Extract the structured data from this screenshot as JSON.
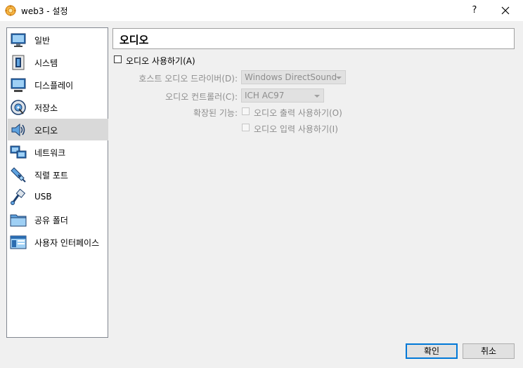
{
  "window": {
    "title": "web3 - 설정",
    "help_glyph": "?",
    "accent": "#0078d7"
  },
  "sidebar": {
    "items": [
      {
        "label": "일반",
        "icon": "general-monitor-icon"
      },
      {
        "label": "시스템",
        "icon": "system-chip-icon"
      },
      {
        "label": "디스플레이",
        "icon": "display-monitor-icon"
      },
      {
        "label": "저장소",
        "icon": "storage-disk-icon"
      },
      {
        "label": "오디오",
        "icon": "audio-speaker-icon",
        "selected": true
      },
      {
        "label": "네트워크",
        "icon": "network-icon"
      },
      {
        "label": "직렬 포트",
        "icon": "serial-port-icon"
      },
      {
        "label": "USB",
        "icon": "usb-icon"
      },
      {
        "label": "공유 폴더",
        "icon": "shared-folder-icon"
      },
      {
        "label": "사용자 인터페이스",
        "icon": "user-interface-icon"
      }
    ]
  },
  "page": {
    "title": "오디오",
    "enable_audio_label": "오디오 사용하기(A)",
    "enable_audio_checked": false,
    "host_driver_label": "호스트 오디오 드라이버(D):",
    "host_driver_value": "Windows DirectSound",
    "controller_label": "오디오 컨트롤러(C):",
    "controller_value": "ICH AC97",
    "extended_label": "확장된 기능:",
    "output_label": "오디오 출력 사용하기(O)",
    "input_label": "오디오 입력 사용하기(I)"
  },
  "footer": {
    "ok_label": "확인",
    "cancel_label": "취소"
  }
}
